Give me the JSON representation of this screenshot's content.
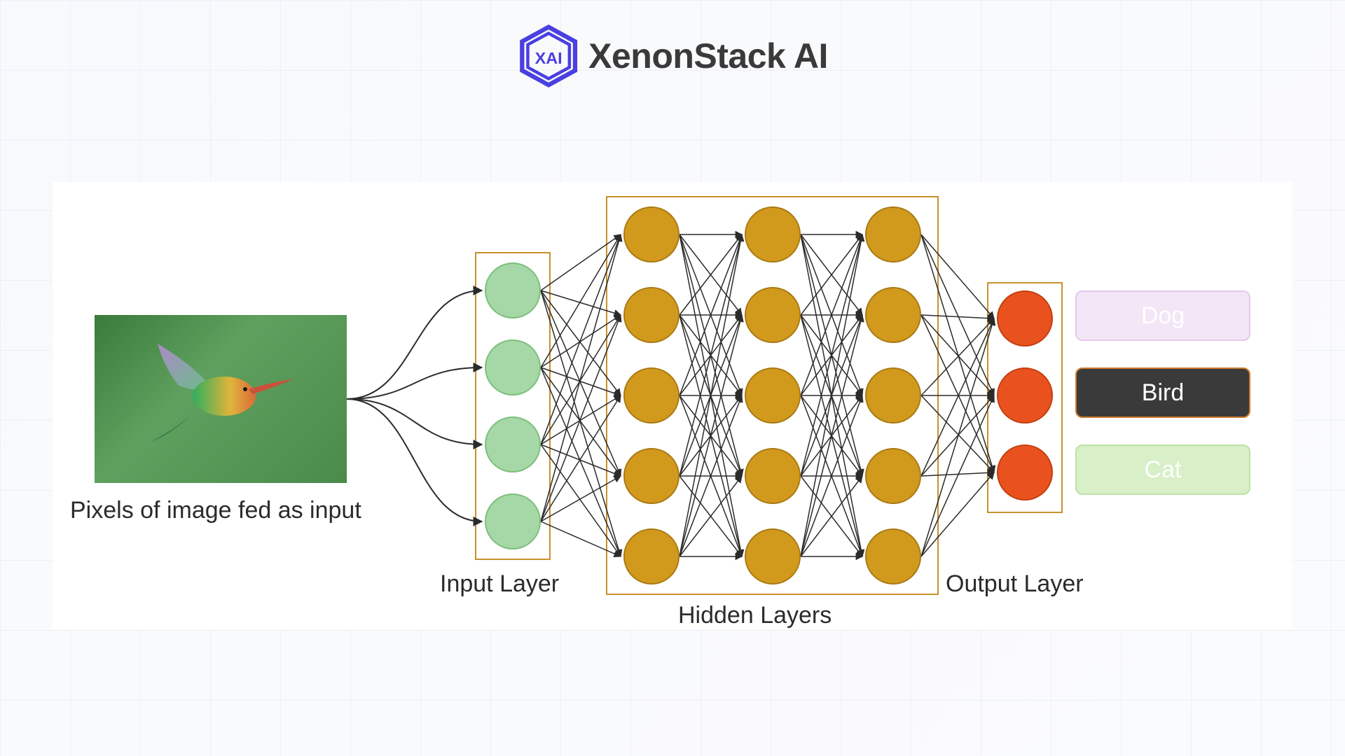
{
  "brand": {
    "name": "XenonStack AI"
  },
  "diagram": {
    "input_caption": "Pixels of image fed as input",
    "input_layer_label": "Input Layer",
    "hidden_layers_label": "Hidden Layers",
    "output_layer_label": "Output Layer",
    "layers": {
      "input": {
        "count": 4,
        "color": "#a6d7a6"
      },
      "hidden": {
        "columns": 3,
        "count_per_column": 5,
        "color": "#d29a1d"
      },
      "output": {
        "count": 3,
        "color": "#e9521e"
      }
    },
    "classes": [
      {
        "label": "Dog",
        "style": "class-dog",
        "predicted": false
      },
      {
        "label": "Bird",
        "style": "class-bird",
        "predicted": true
      },
      {
        "label": "Cat",
        "style": "class-cat",
        "predicted": false
      }
    ],
    "input_image_subject": "hummingbird"
  }
}
